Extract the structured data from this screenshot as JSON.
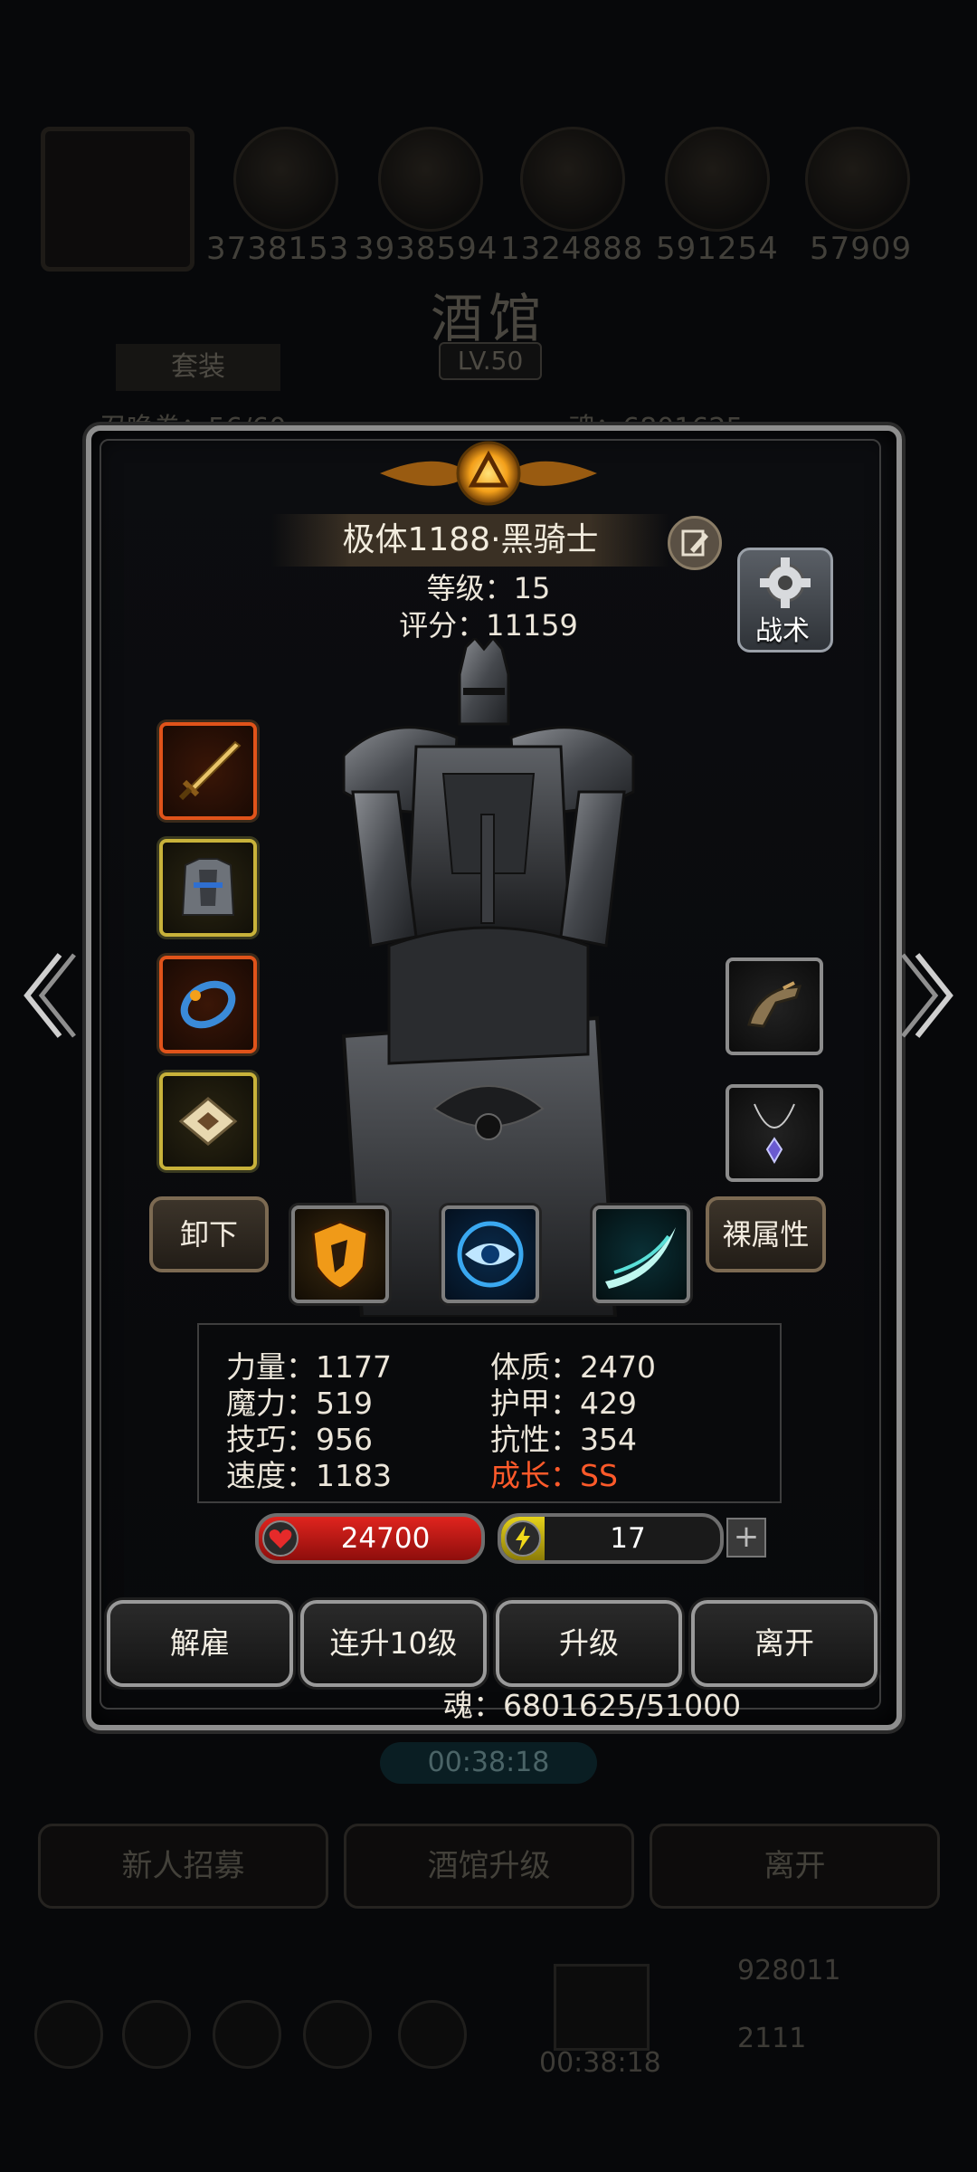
{
  "background": {
    "resources": [
      "3738153",
      "3938594",
      "1324888",
      "591254",
      "57909"
    ],
    "title": "酒馆",
    "level": "LV.50",
    "tab_label": "套装",
    "recruit_count": "召唤卷：56/60",
    "soul_top": "魂：6801625",
    "timer": "00:38:18",
    "buttons": {
      "recruit": "新人招募",
      "upgrade_tavern": "酒馆升级",
      "leave": "离开"
    },
    "bottom": {
      "timer": "00:38:18",
      "gold": "928011",
      "gems": "2111"
    }
  },
  "hero": {
    "name": "极体1188·黑骑士",
    "level_label": "等级：15",
    "score_label": "评分：11159",
    "tactic_label": "战术"
  },
  "equipment": {
    "left_slots": [
      "sword-icon",
      "armor-icon",
      "bracer-icon",
      "scroll-icon"
    ],
    "right_slots": [
      "gauntlet-icon",
      "necklace-icon"
    ],
    "skills": [
      "shield-skill-icon",
      "eye-skill-icon",
      "slash-skill-icon"
    ],
    "unequip_label": "卸下",
    "base_attr_label": "裸属性"
  },
  "stats": {
    "strength": "力量：1177",
    "magic": "魔力：519",
    "skill": "技巧：956",
    "speed": "速度：1183",
    "constitution": "体质：2470",
    "armor": "护甲：429",
    "resistance": "抗性：354",
    "growth": "成长：SS"
  },
  "bars": {
    "hp": "24700",
    "energy": "17",
    "energy_fill": 0.2
  },
  "actions": {
    "dismiss": "解雇",
    "level10": "连升10级",
    "upgrade": "升级",
    "leave": "离开"
  },
  "soul_cost": "魂：6801625/51000",
  "colors": {
    "growth": "#ff5a2a",
    "hp": "#e0241e",
    "energy": "#e6d21a",
    "accent": "#f4a01a"
  }
}
